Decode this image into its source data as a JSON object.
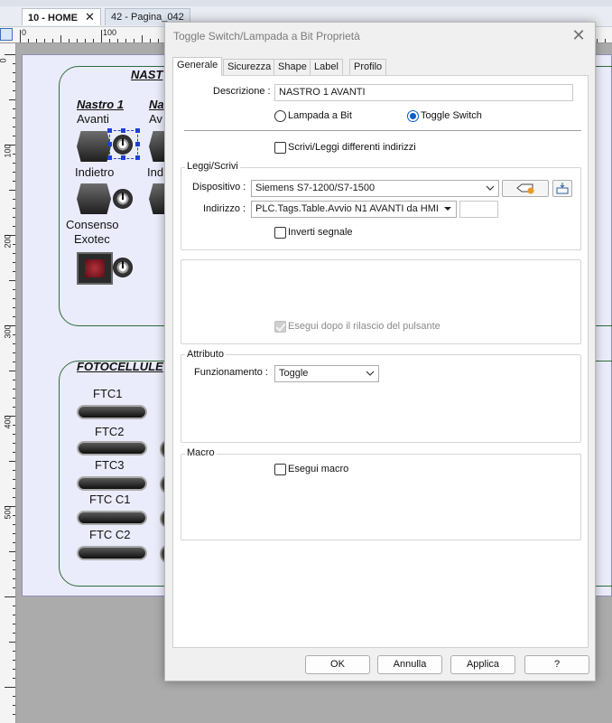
{
  "editor": {
    "tabs": [
      {
        "label": "10 - HOME",
        "close": "✕"
      },
      {
        "label": "42 - Pagina_042"
      }
    ],
    "ruler_h_labels": [
      "0",
      "100"
    ],
    "ruler_v_labels": [
      "0",
      "100",
      "200",
      "300",
      "400",
      "500"
    ],
    "canvas": {
      "group1_title": "NAST",
      "nastro1_label": "Nastro 1",
      "nastro2_label_partial": "Na",
      "avanti_label": "Avanti",
      "avanti_label_partial": "Av",
      "indietro_label": "Indietro",
      "indietro_label_partial": "Ind",
      "consenso_label": "Consenso",
      "exotec_label": "Exotec",
      "group2_title": "FOTOCELLULE",
      "ftc_labels": [
        "FTC1",
        "FTC2",
        "FTC3",
        "FTC C1",
        "FTC C2"
      ]
    }
  },
  "dialog": {
    "title": "Toggle Switch/Lampada a Bit Proprietà",
    "close_glyph": "✕",
    "tabs": [
      "Generale",
      "Sicurezza",
      "Shape",
      "Label",
      "Profilo"
    ],
    "descrizione_label": "Descrizione :",
    "descrizione_value": "NASTRO 1 AVANTI",
    "radio_lampada": "Lampada a Bit",
    "radio_toggle": "Toggle Switch",
    "selected_radio": "Toggle Switch",
    "scrivi_leggi_label": "Scrivi/Leggi differenti indirizzi",
    "leggi_scrivi_title": "Leggi/Scrivi",
    "dispositivo_label": "Dispositivo :",
    "dispositivo_value": "Siemens S7-1200/S7-1500",
    "indirizzo_label": "Indirizzo :",
    "indirizzo_value": "PLC.Tags.Table.Avvio N1 AVANTI da HMI",
    "inverti_label": "Inverti segnale",
    "esegui_rilascio_label": "Esegui dopo il rilascio del pulsante",
    "attributo_title": "Attributo",
    "funzionamento_label": "Funzionamento :",
    "funzionamento_value": "Toggle",
    "macro_title": "Macro",
    "esegui_macro_label": "Esegui macro",
    "buttons": {
      "ok": "OK",
      "annulla": "Annulla",
      "applica": "Applica",
      "help": "?"
    }
  },
  "colors": {
    "accent": "#0a5fc4",
    "canvas_bg": "#ebecfb",
    "group_border": "#2e6b3a",
    "selection": "#1f3fd6"
  },
  "icons": [
    "close-icon",
    "chevron-down-icon",
    "tag-icon",
    "keyboard-icon",
    "power-knob-icon"
  ]
}
